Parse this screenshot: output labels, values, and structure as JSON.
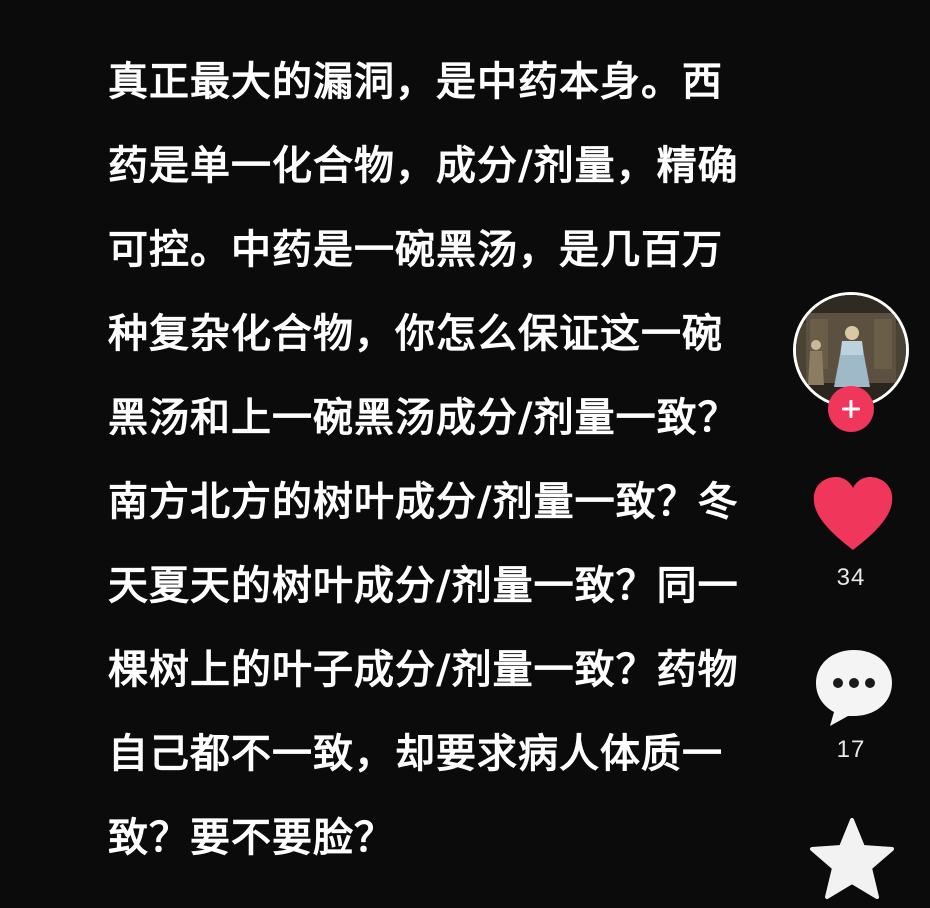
{
  "post": {
    "lines": [
      "真正最大的漏洞，是中药本身。西",
      "药是单一化合物，成分/剂量，精确",
      "可控。中药是一碗黑汤，是几百万",
      "种复杂化合物，你怎么保证这一碗",
      "黑汤和上一碗黑汤成分/剂量一致？",
      "南方北方的树叶成分/剂量一致？冬",
      "天夏天的树叶成分/剂量一致？同一",
      "棵树上的叶子成分/剂量一致？药物",
      "自己都不一致，却要求病人体质一",
      "致？要不要脸？"
    ]
  },
  "actions": {
    "like_count": "34",
    "comment_count": "17"
  },
  "icons": {
    "avatar": "author-avatar",
    "follow": "plus-icon",
    "like": "heart-icon",
    "comment": "comment-bubble-icon",
    "favorite": "star-icon"
  },
  "colors": {
    "background": "#0b0b0b",
    "text": "#ffffff",
    "accent": "#f0365a",
    "icon": "#ffffff"
  }
}
